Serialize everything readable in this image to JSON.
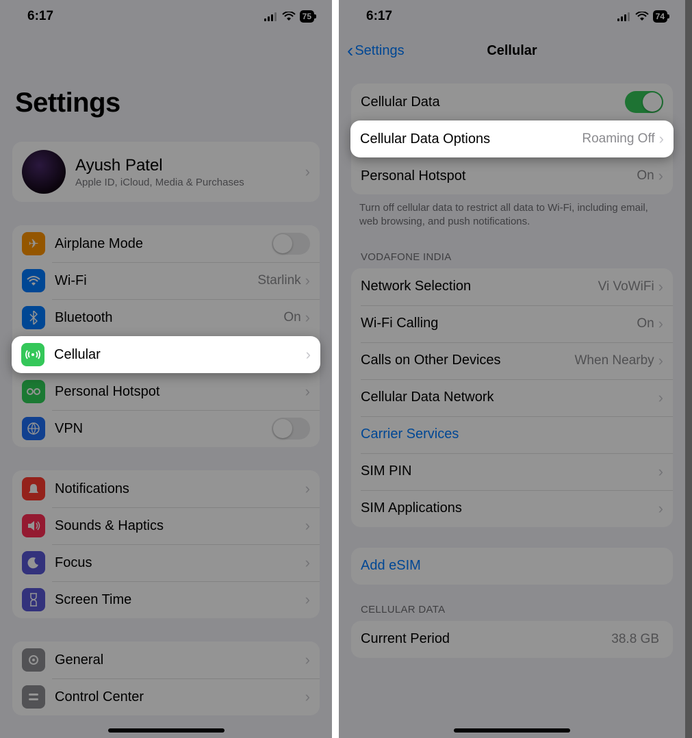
{
  "left": {
    "status": {
      "time": "6:17",
      "battery": "75"
    },
    "title": "Settings",
    "profile": {
      "name": "Ayush Patel",
      "subtitle": "Apple ID, iCloud, Media & Purchases"
    },
    "g1": {
      "airplane": "Airplane Mode",
      "wifi": "Wi-Fi",
      "wifi_value": "Starlink",
      "bluetooth": "Bluetooth",
      "bluetooth_value": "On",
      "cellular": "Cellular",
      "hotspot": "Personal Hotspot",
      "vpn": "VPN"
    },
    "g2": {
      "notifications": "Notifications",
      "sounds": "Sounds & Haptics",
      "focus": "Focus",
      "screentime": "Screen Time"
    },
    "g3": {
      "general": "General",
      "controlcenter": "Control Center"
    }
  },
  "right": {
    "status": {
      "time": "6:17",
      "battery": "74"
    },
    "nav": {
      "back": "Settings",
      "title": "Cellular"
    },
    "g1": {
      "cellular_data": "Cellular Data",
      "data_options": "Cellular Data Options",
      "data_options_value": "Roaming Off",
      "hotspot": "Personal Hotspot",
      "hotspot_value": "On"
    },
    "footer1": "Turn off cellular data to restrict all data to Wi-Fi, including email, web browsing, and push notifications.",
    "header2": "VODAFONE INDIA",
    "g2": {
      "network_selection": "Network Selection",
      "network_selection_value": "Vi VoWiFi",
      "wifi_calling": "Wi-Fi Calling",
      "wifi_calling_value": "On",
      "calls_other": "Calls on Other Devices",
      "calls_other_value": "When Nearby",
      "data_network": "Cellular Data Network",
      "carrier_services": "Carrier Services",
      "sim_pin": "SIM PIN",
      "sim_apps": "SIM Applications"
    },
    "g3": {
      "add_esim": "Add eSIM"
    },
    "header4": "CELLULAR DATA",
    "g4": {
      "current_period": "Current Period",
      "current_period_value": "38.8 GB"
    }
  }
}
